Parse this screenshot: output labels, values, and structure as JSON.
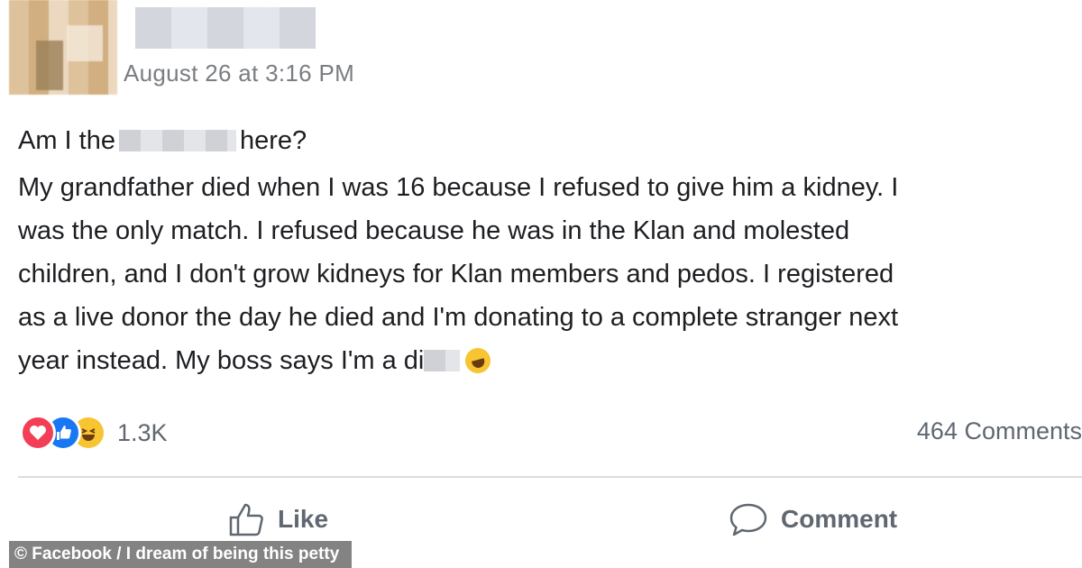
{
  "post": {
    "timestamp": "August 26 at 3:16 PM",
    "title_before": "Am I the",
    "title_after": "here?",
    "body_lines": [
      "My grandfather died when I was 16 because I refused to give him a kidney. I",
      "was the only match. I refused because he was in the Klan and molested",
      "children, and I don't grow kidneys for Klan members and pedos. I registered",
      "as a live donor the day he died and I'm donating to a complete stranger next"
    ],
    "last_line": "year instead. My boss says I'm a di"
  },
  "reactions": {
    "icons": [
      "heart-icon",
      "thumbs-up-icon",
      "laughing-emoji-icon"
    ],
    "count": "1.3K"
  },
  "comments": {
    "count_label": "464 Comments"
  },
  "actions": {
    "like_label": "Like",
    "comment_label": "Comment"
  },
  "credit": {
    "text": "© Facebook / I dream of being this petty"
  },
  "colors": {
    "love": "#f33e58",
    "like": "#1877f2",
    "haha": "#f7c531",
    "muted_text": "#606770"
  }
}
